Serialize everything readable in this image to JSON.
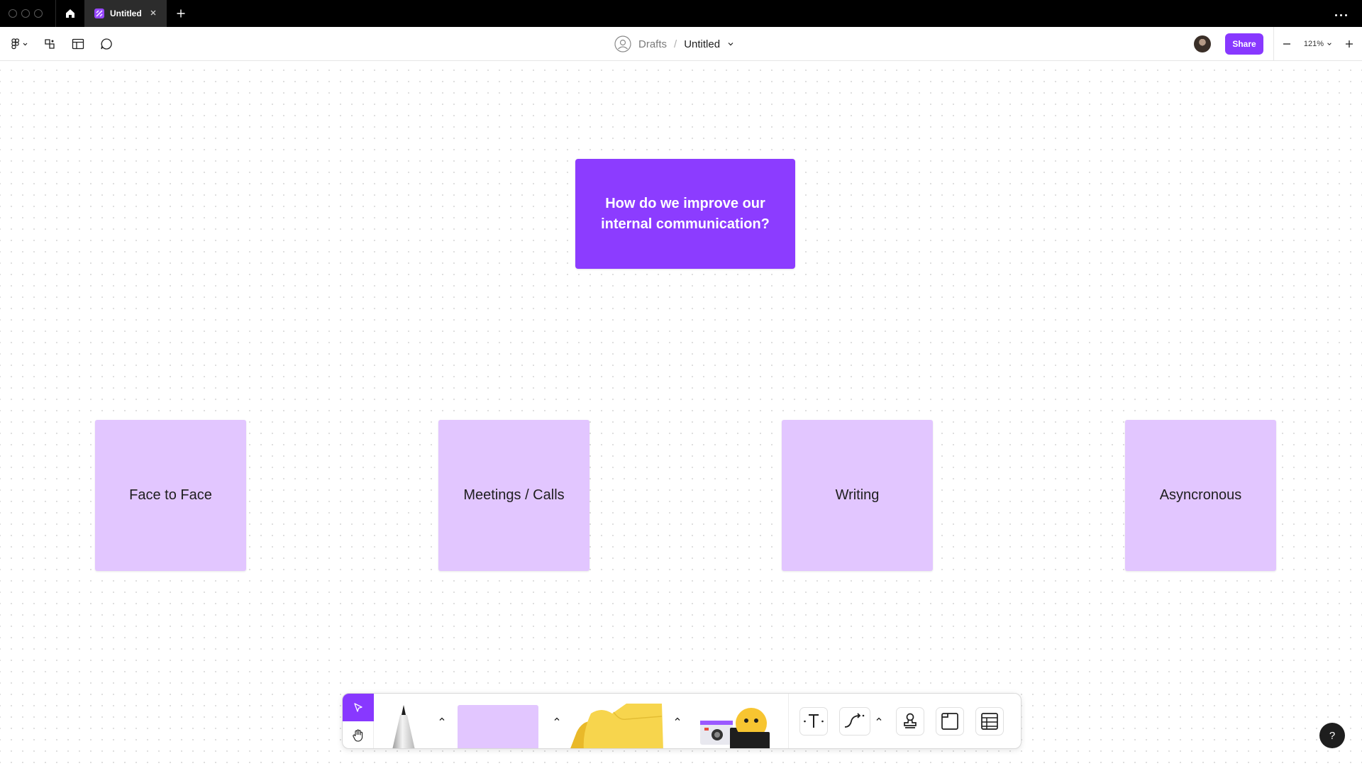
{
  "tabbar": {
    "active_tab": {
      "title": "Untitled",
      "icon": "figjam-file-icon"
    },
    "home_icon": "home-icon",
    "new_tab_icon": "plus-icon",
    "more_icon": "ellipsis-icon"
  },
  "toolbar": {
    "main_menu_icon": "figma-logo-icon",
    "tools": [
      "ai-tools-icon",
      "templates-icon",
      "comment-icon"
    ],
    "breadcrumb": {
      "location": "Drafts",
      "separator": "/",
      "file_name": "Untitled"
    },
    "share_label": "Share",
    "zoom_value": "121%",
    "accent": "#8838ff"
  },
  "canvas": {
    "question_card": {
      "text": "How do we improve our internal communication?",
      "color": "#8c3cff"
    },
    "sticky_notes": [
      {
        "text": "Face to Face",
        "color": "#e2c6ff"
      },
      {
        "text": "Meetings / Calls",
        "color": "#e2c6ff"
      },
      {
        "text": "Writing",
        "color": "#e2c6ff"
      },
      {
        "text": "Asyncronous",
        "color": "#e2c6ff"
      }
    ]
  },
  "dock": {
    "tools": [
      "move-tool-icon",
      "hand-tool-icon",
      "marker-tool",
      "sticky-note-tool",
      "shapes-tool",
      "stamps-tool",
      "text-tool-icon",
      "connector-tool-icon",
      "stamp-icon",
      "section-tool-icon",
      "table-tool-icon"
    ]
  },
  "help": {
    "label": "?"
  }
}
